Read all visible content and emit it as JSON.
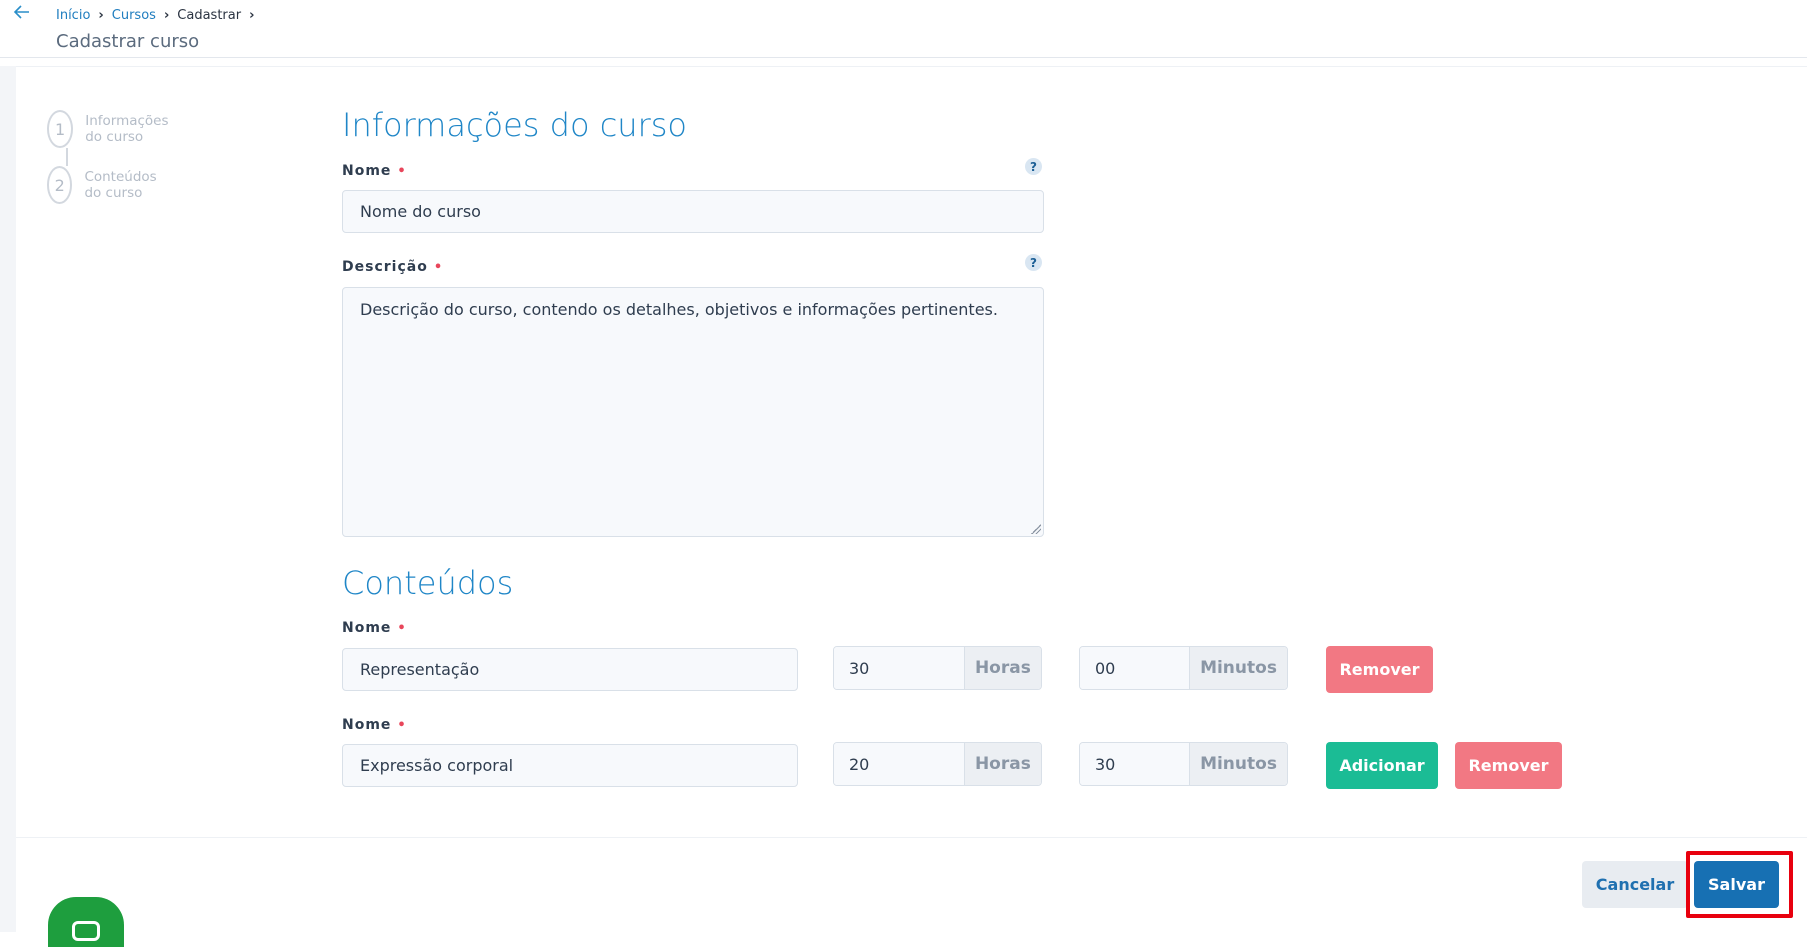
{
  "header": {
    "breadcrumb": [
      "Início",
      "Cursos",
      "Cadastrar"
    ],
    "title": "Cadastrar curso"
  },
  "stepper": {
    "steps": [
      {
        "number": "1",
        "label": "Informações do curso"
      },
      {
        "number": "2",
        "label": "Conteúdos do curso"
      }
    ]
  },
  "info_section": {
    "title": "Informações do curso",
    "name_label": "Nome",
    "name_value": "Nome do curso",
    "description_label": "Descrição",
    "description_value": "Descrição do curso, contendo os detalhes, objetivos e informações pertinentes.",
    "help": "?",
    "required_mark": "•"
  },
  "contents_section": {
    "title": "Conteúdos",
    "rows": [
      {
        "label": "Nome",
        "name": "Representação",
        "hours": "30",
        "hours_unit": "Horas",
        "minutes": "00",
        "minutes_unit": "Minutos",
        "remove": "Remover"
      },
      {
        "label": "Nome",
        "name": "Expressão corporal",
        "hours": "20",
        "hours_unit": "Horas",
        "minutes": "30",
        "minutes_unit": "Minutos",
        "add": "Adicionar",
        "remove": "Remover"
      }
    ]
  },
  "footer": {
    "cancel": "Cancelar",
    "save": "Salvar"
  },
  "colors": {
    "accent": "#1f86c7",
    "remove": "#f27883",
    "add": "#1bbc95",
    "save": "#1770b3",
    "highlight": "#e8000e"
  },
  "icons": {
    "back": "arrow-left-icon",
    "chat": "chat-icon"
  }
}
